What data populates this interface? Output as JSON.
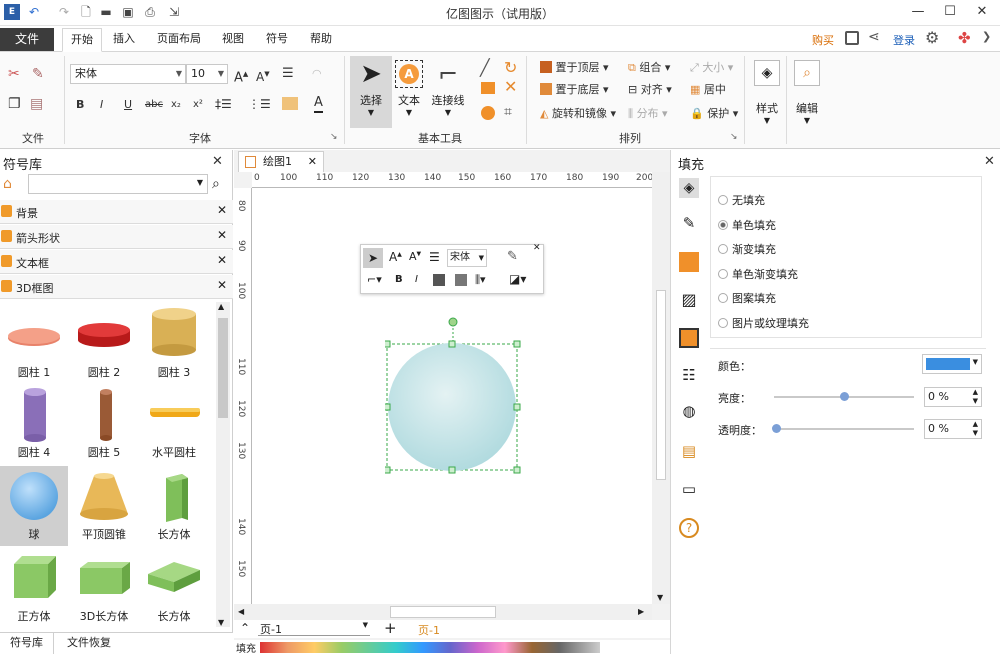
{
  "app_title": "亿图图示（试用版）",
  "menu": {
    "file": "文件",
    "tabs": [
      "开始",
      "插入",
      "页面布局",
      "视图",
      "符号",
      "帮助"
    ],
    "buy": "购买",
    "login": "登录"
  },
  "ribbon": {
    "groups": {
      "file": "文件",
      "font": "字体",
      "basic_tools": "基本工具",
      "arrange": "排列"
    },
    "font_name": "宋体",
    "font_size": "10",
    "select": "选择",
    "text": "文本",
    "connector": "连接线",
    "bring_front": "置于顶层",
    "send_back": "置于底层",
    "rotate_mirror": "旋转和镜像",
    "group": "组合",
    "align": "对齐",
    "distribute": "分布",
    "size": "大小",
    "center": "居中",
    "protect": "保护",
    "style": "样式",
    "edit": "编辑"
  },
  "library": {
    "title": "符号库",
    "categories": [
      "背景",
      "箭头形状",
      "文本框",
      "3D框图"
    ],
    "shapes": [
      "圆柱 1",
      "圆柱 2",
      "圆柱 3",
      "圆柱 4",
      "圆柱 5",
      "水平圆柱",
      "球",
      "平顶圆锥",
      "长方体",
      "正方体",
      "3D长方体",
      "长方体"
    ],
    "tab_library": "符号库",
    "tab_recover": "文件恢复"
  },
  "canvas": {
    "doc_tab": "绘图1",
    "hruler_ticks": [
      "0",
      "100",
      "110",
      "120",
      "130",
      "140",
      "150",
      "160",
      "170",
      "180",
      "190",
      "200"
    ],
    "vruler_ticks": [
      "80",
      "90",
      "100",
      "110",
      "120",
      "130",
      "140",
      "150"
    ],
    "page_select": "页-1",
    "page_tab": "页-1",
    "fill_label": "填充",
    "mini_font": "宋体"
  },
  "fill_panel": {
    "title": "填充",
    "options": [
      "无填充",
      "单色填充",
      "渐变填充",
      "单色渐变填充",
      "图案填充",
      "图片或纹理填充"
    ],
    "selected_index": 1,
    "color_label": "颜色：",
    "brightness_label": "亮度：",
    "transparency_label": "透明度：",
    "brightness_value": "0 %",
    "transparency_value": "0 %",
    "fill_color": "#3a8ee0"
  }
}
